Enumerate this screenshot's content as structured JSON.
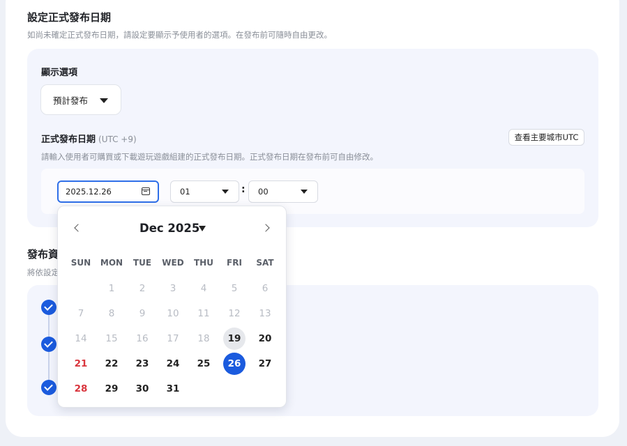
{
  "release": {
    "title": "設定正式發布日期",
    "subtitle": "如尚未確定正式發布日期，請設定要顯示予使用者的選項。在發布前可隨時自由更改。",
    "display_label": "顯示選項",
    "display_value": "預計發布",
    "date_label": "正式發布日期",
    "date_utc": "(UTC +9)",
    "utc_button": "查看主要城市UTC",
    "date_desc": "請輸入使用者可購買或下載遊玩遊戲組建的正式發布日期。正式發布日期在發布前可自由修改。",
    "date_value": "2025.12.26",
    "hour_value": "01",
    "minute_value": "00",
    "colon": ":"
  },
  "section2": {
    "title_partial": "發布資",
    "sub_partial": "將依設定"
  },
  "calendar": {
    "month_label": "Dec 2025",
    "weekdays": [
      "SUN",
      "MON",
      "TUE",
      "WED",
      "THU",
      "FRI",
      "SAT"
    ],
    "days": [
      {
        "label": "",
        "state": "blank"
      },
      {
        "label": "1",
        "state": "muted"
      },
      {
        "label": "2",
        "state": "muted"
      },
      {
        "label": "3",
        "state": "muted"
      },
      {
        "label": "4",
        "state": "muted"
      },
      {
        "label": "5",
        "state": "muted"
      },
      {
        "label": "6",
        "state": "muted"
      },
      {
        "label": "7",
        "state": "muted"
      },
      {
        "label": "8",
        "state": "muted"
      },
      {
        "label": "9",
        "state": "muted"
      },
      {
        "label": "10",
        "state": "muted"
      },
      {
        "label": "11",
        "state": "muted"
      },
      {
        "label": "12",
        "state": "muted"
      },
      {
        "label": "13",
        "state": "muted"
      },
      {
        "label": "14",
        "state": "muted"
      },
      {
        "label": "15",
        "state": "muted"
      },
      {
        "label": "16",
        "state": "muted"
      },
      {
        "label": "17",
        "state": "muted"
      },
      {
        "label": "18",
        "state": "muted"
      },
      {
        "label": "19",
        "state": "today"
      },
      {
        "label": "20",
        "state": "normal"
      },
      {
        "label": "21",
        "state": "sunday"
      },
      {
        "label": "22",
        "state": "normal"
      },
      {
        "label": "23",
        "state": "normal"
      },
      {
        "label": "24",
        "state": "normal"
      },
      {
        "label": "25",
        "state": "normal"
      },
      {
        "label": "26",
        "state": "selected"
      },
      {
        "label": "27",
        "state": "normal"
      },
      {
        "label": "28",
        "state": "sunday"
      },
      {
        "label": "29",
        "state": "normal"
      },
      {
        "label": "30",
        "state": "normal"
      },
      {
        "label": "31",
        "state": "normal"
      }
    ]
  },
  "colors": {
    "accent": "#1b5bde",
    "sunday": "#d9363e",
    "panel_bg": "#f3f5fd"
  },
  "icons": {
    "prev": "chevron-left-icon",
    "next": "chevron-right-icon",
    "calendar": "calendar-icon",
    "dropdown": "caret-down-icon",
    "check": "check-circle-icon"
  }
}
